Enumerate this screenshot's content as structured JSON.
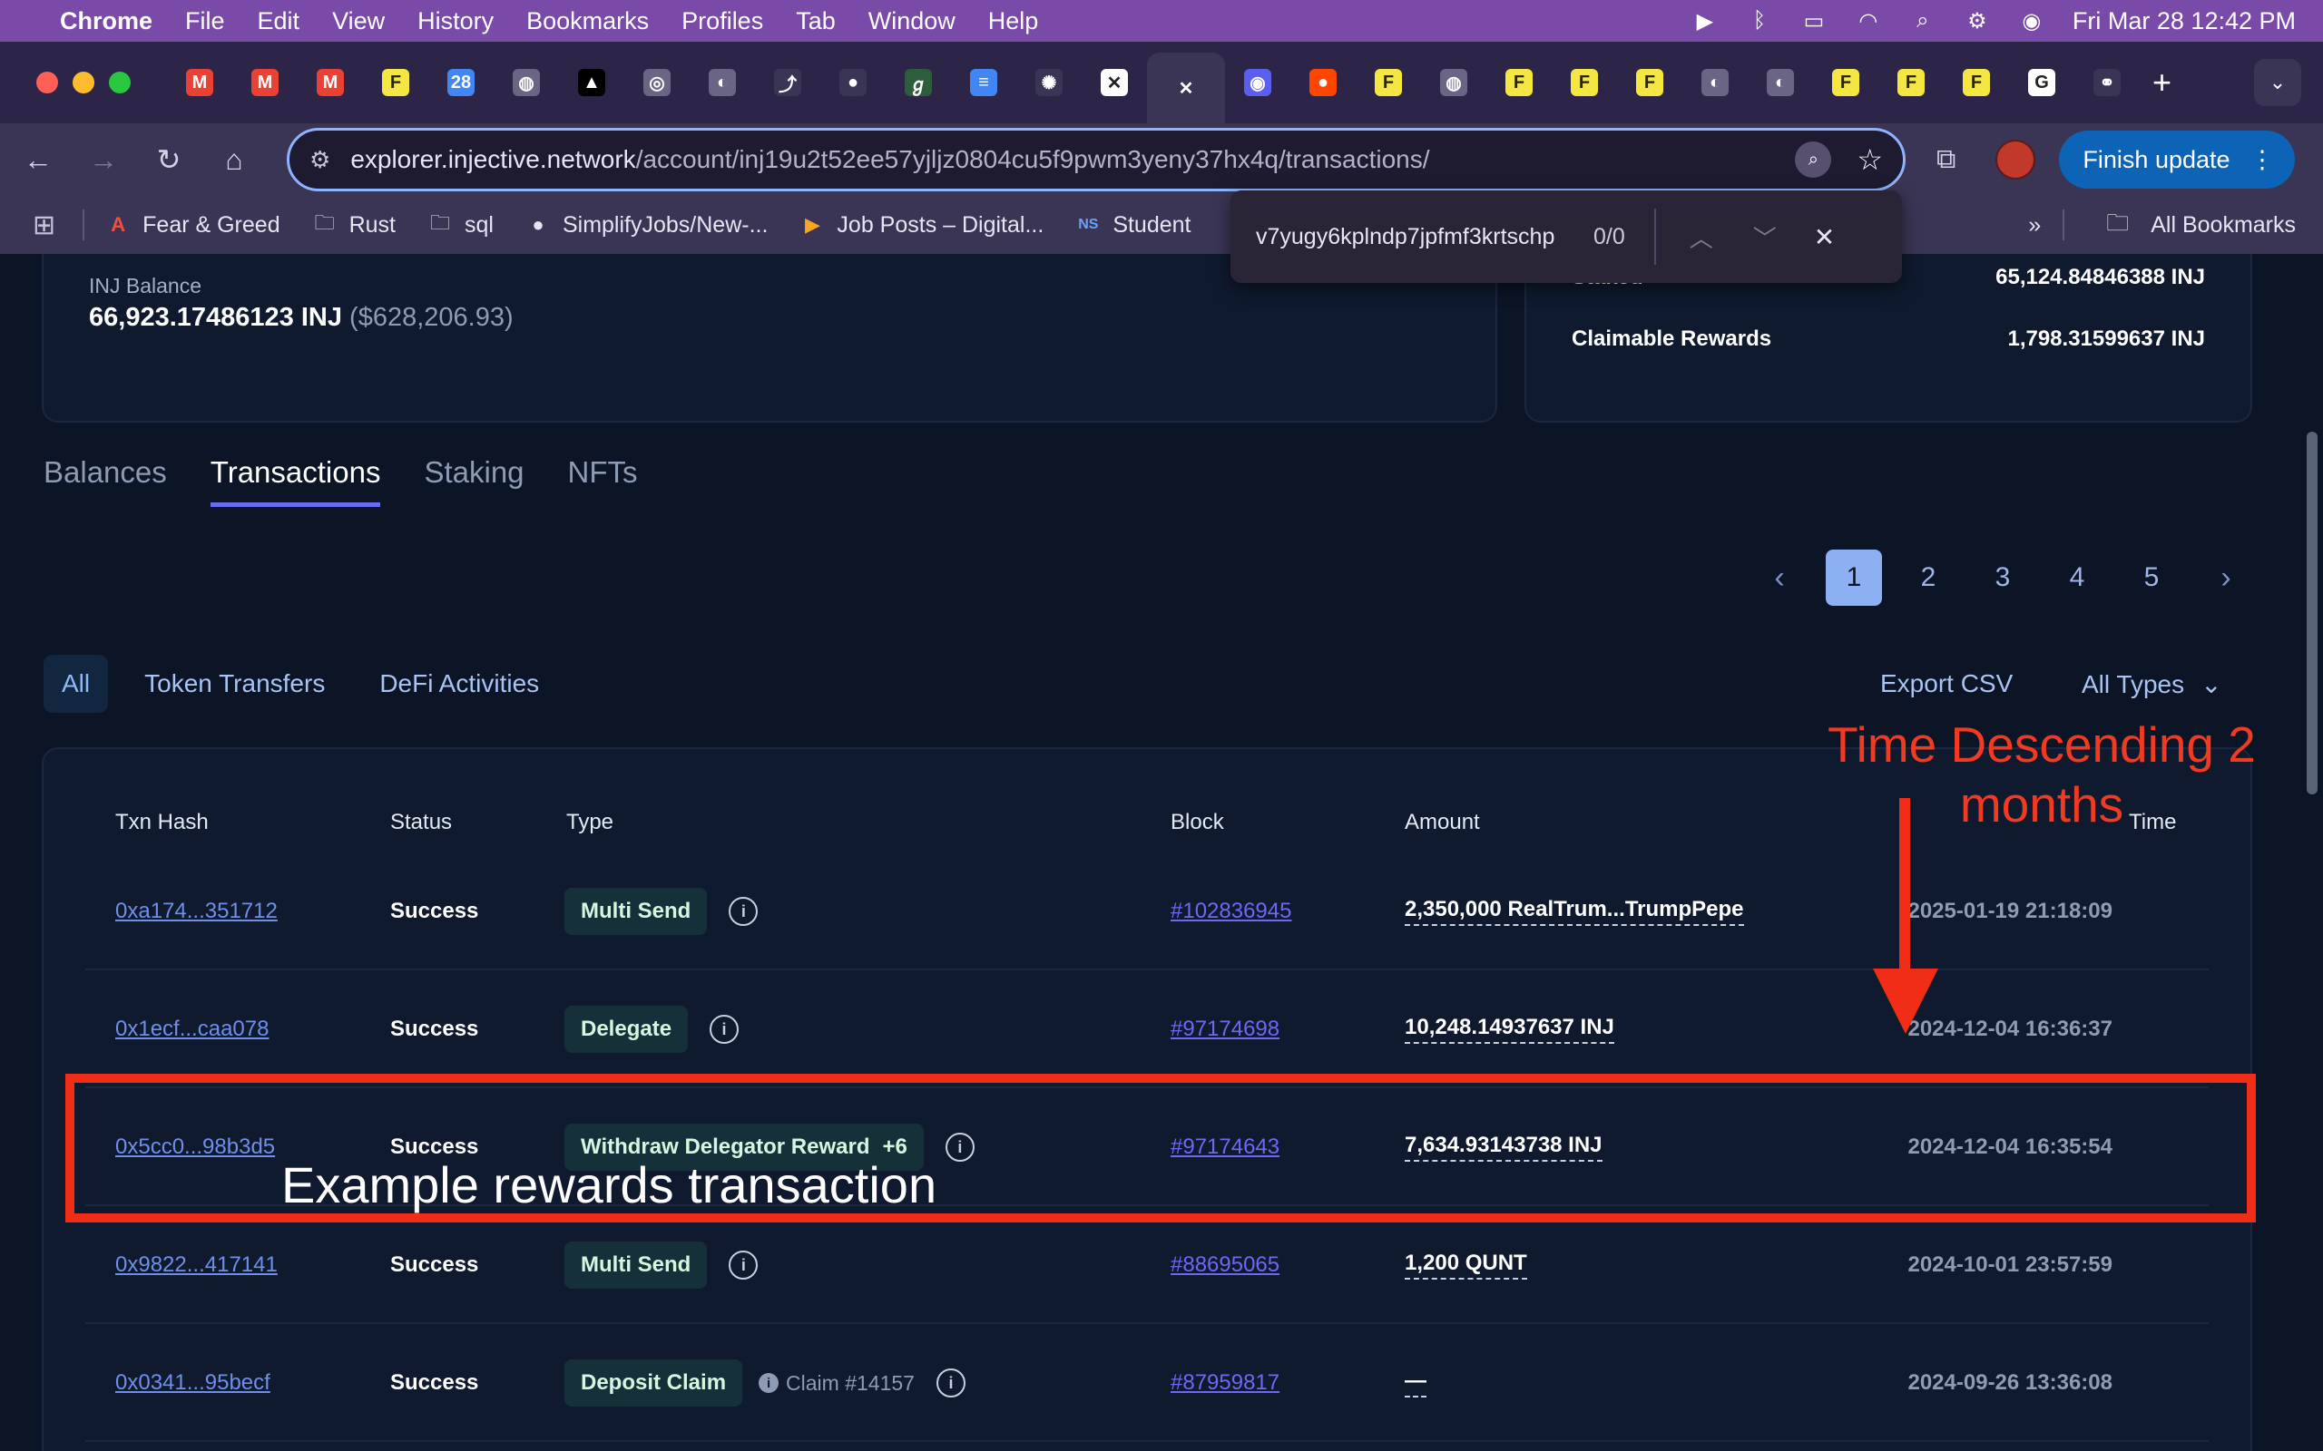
{
  "menubar": {
    "app": "Chrome",
    "items": [
      "File",
      "Edit",
      "View",
      "History",
      "Bookmarks",
      "Profiles",
      "Tab",
      "Window",
      "Help"
    ],
    "clock": "Fri Mar 28  12:42 PM"
  },
  "tabs": [
    {
      "icon": "gmail-icon",
      "glyph": "M",
      "color": "#e94235"
    },
    {
      "icon": "gmail-icon",
      "glyph": "M",
      "color": "#e94235"
    },
    {
      "icon": "gmail-icon",
      "glyph": "M",
      "color": "#e94235"
    },
    {
      "icon": "f-icon",
      "glyph": "F",
      "color": "#f5e642"
    },
    {
      "icon": "calendar-icon",
      "glyph": "28",
      "color": "#4285f4"
    },
    {
      "icon": "globe-icon",
      "glyph": "◍",
      "color": "#6b6585"
    },
    {
      "icon": "triangle-icon",
      "glyph": "▲",
      "color": "#000000"
    },
    {
      "icon": "spiral-icon",
      "glyph": "◎",
      "color": "#6b6585"
    },
    {
      "icon": "chart-icon",
      "glyph": "◐",
      "color": "#6b6585"
    },
    {
      "icon": "link-icon",
      "glyph": "⤴",
      "color": "#3a3554"
    },
    {
      "icon": "github-icon",
      "glyph": "●",
      "color": "#3a3554"
    },
    {
      "icon": "leaf-icon",
      "glyph": "ℊ",
      "color": "#2c5e3c"
    },
    {
      "icon": "docs-icon",
      "glyph": "≡",
      "color": "#4285f4"
    },
    {
      "icon": "openai-icon",
      "glyph": "✺",
      "color": "#3a3554"
    },
    {
      "icon": "x-icon",
      "glyph": "✕",
      "color": "#ffffff"
    },
    {
      "icon": "close-tab-icon",
      "glyph": "✕",
      "color": "#3a3554"
    },
    {
      "icon": "injective-icon",
      "glyph": "◉",
      "color": "#5b5ff0"
    },
    {
      "icon": "reddit-icon",
      "glyph": "●",
      "color": "#ff4500"
    },
    {
      "icon": "f-icon",
      "glyph": "F",
      "color": "#f5e642"
    },
    {
      "icon": "globe-icon",
      "glyph": "◍",
      "color": "#6b6585"
    },
    {
      "icon": "f-icon",
      "glyph": "F",
      "color": "#f5e642"
    },
    {
      "icon": "f-icon",
      "glyph": "F",
      "color": "#f5e642"
    },
    {
      "icon": "f-icon",
      "glyph": "F",
      "color": "#f5e642"
    },
    {
      "icon": "chart-icon",
      "glyph": "◐",
      "color": "#6b6585"
    },
    {
      "icon": "chart-icon",
      "glyph": "◐",
      "color": "#6b6585"
    },
    {
      "icon": "f-icon",
      "glyph": "F",
      "color": "#f5e642"
    },
    {
      "icon": "f-icon",
      "glyph": "F",
      "color": "#f5e642"
    },
    {
      "icon": "f-icon",
      "glyph": "F",
      "color": "#f5e642"
    },
    {
      "icon": "google-icon",
      "glyph": "G",
      "color": "#ffffff"
    },
    {
      "icon": "link-icon",
      "glyph": "⚭",
      "color": "#3a3554"
    }
  ],
  "address": {
    "host": "explorer.injective.network",
    "path": "/account/inj19u2t52ee57yjljz0804cu5f9pwm3yeny37hx4q/transactions/"
  },
  "finish_update": "Finish update",
  "bookmarks": [
    {
      "label": "Fear & Greed",
      "icon": "fear-greed-icon"
    },
    {
      "label": "Rust",
      "icon": "folder-icon"
    },
    {
      "label": "sql",
      "icon": "folder-icon"
    },
    {
      "label": "SimplifyJobs/New-...",
      "icon": "github-icon"
    },
    {
      "label": "Job Posts – Digital...",
      "icon": "arrow-icon"
    },
    {
      "label": "Student",
      "icon": "nscc-icon"
    }
  ],
  "all_bookmarks": "All Bookmarks",
  "find": {
    "query": "v7yugy6kplndp7jpfmf3krtschp",
    "count": "0/0"
  },
  "balance": {
    "label": "INJ Balance",
    "value": "66,923.17486123 INJ",
    "usd": "($628,206.93)"
  },
  "staking": {
    "staked_label": "Staked",
    "staked_value": "65,124.84846388 INJ",
    "rewards_label": "Claimable Rewards",
    "rewards_value": "1,798.31599637 INJ"
  },
  "page_tabs": [
    "Balances",
    "Transactions",
    "Staking",
    "NFTs"
  ],
  "active_tab": "Transactions",
  "pagination": [
    "1",
    "2",
    "3",
    "4",
    "5"
  ],
  "filters": [
    "All",
    "Token Transfers",
    "DeFi Activities"
  ],
  "export_label": "Export CSV",
  "all_types_label": "All Types",
  "table": {
    "headers": {
      "hash": "Txn Hash",
      "status": "Status",
      "type": "Type",
      "block": "Block",
      "amount": "Amount",
      "time": "Time"
    },
    "rows": [
      {
        "hash": "0xa174...351712",
        "status": "Success",
        "type": "Multi Send",
        "extra": "",
        "claim": "",
        "block": "#102836945",
        "amount": "2,350,000 RealTrum...TrumpPepe",
        "time": "2025-01-19 21:18:09"
      },
      {
        "hash": "0x1ecf...caa078",
        "status": "Success",
        "type": "Delegate",
        "extra": "",
        "claim": "",
        "block": "#97174698",
        "amount": "10,248.14937637 INJ",
        "time": "2024-12-04 16:36:37"
      },
      {
        "hash": "0x5cc0...98b3d5",
        "status": "Success",
        "type": "Withdraw Delegator Reward",
        "extra": "+6",
        "claim": "",
        "block": "#97174643",
        "amount": "7,634.93143738 INJ",
        "time": "2024-12-04 16:35:54"
      },
      {
        "hash": "0x9822...417141",
        "status": "Success",
        "type": "Multi Send",
        "extra": "",
        "claim": "",
        "block": "#88695065",
        "amount": "1,200 QUNT",
        "time": "2024-10-01 23:57:59"
      },
      {
        "hash": "0x0341...95becf",
        "status": "Success",
        "type": "Deposit Claim",
        "extra": "",
        "claim": "Claim #14157",
        "block": "#87959817",
        "amount": "—",
        "time": "2024-09-26 13:36:08"
      }
    ]
  },
  "annotations": {
    "arrow_text_line1": "Time Descending 2",
    "arrow_text_line2": "months",
    "box_label": "Example rewards transaction"
  }
}
